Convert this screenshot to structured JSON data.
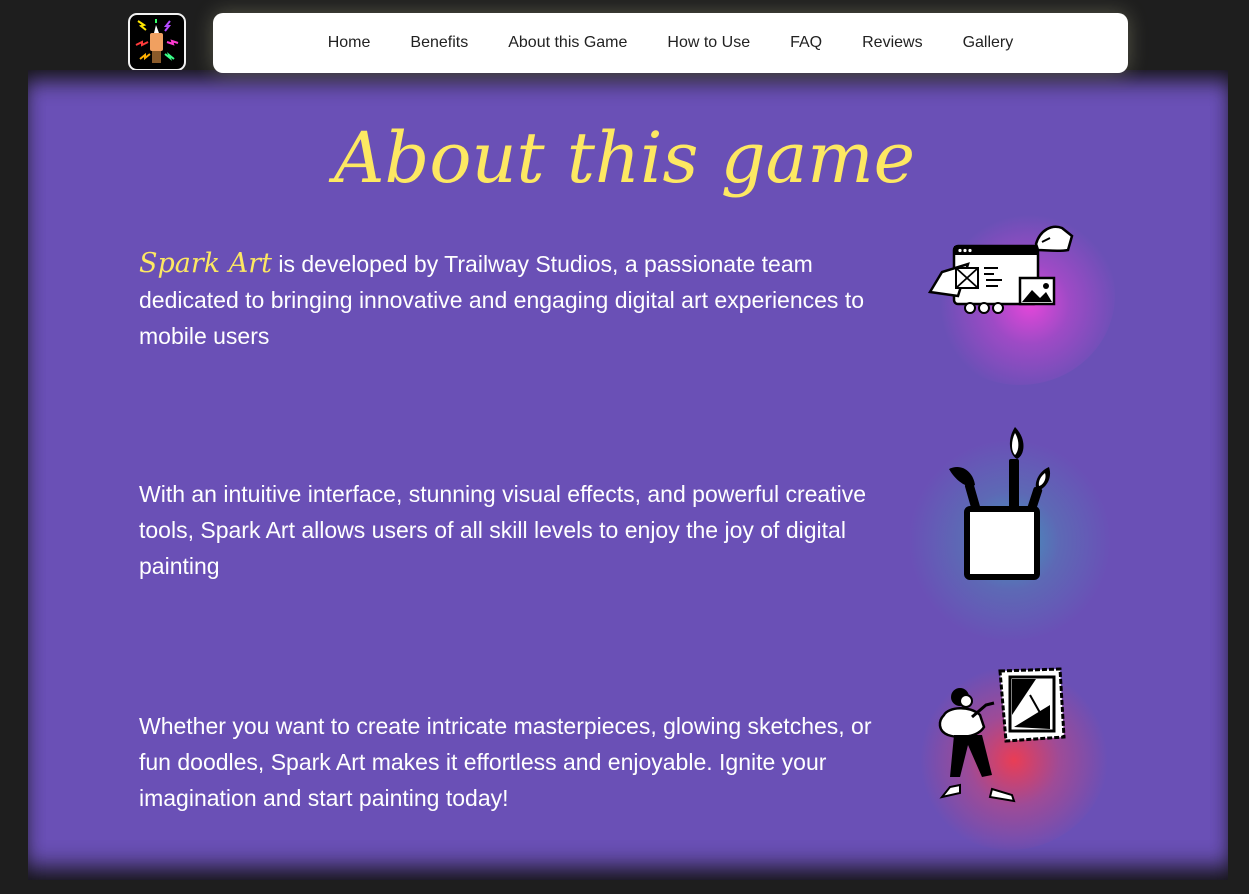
{
  "nav": {
    "items": [
      "Home",
      "Benefits",
      "About this Game",
      "How to Use",
      "FAQ",
      "Reviews",
      "Gallery"
    ]
  },
  "about": {
    "title": "About this game",
    "p1_brand": "Spark Art",
    "p1_rest": " is developed by Trailway Studios, a passionate team dedicated to bringing innovative and engaging digital art experiences to mobile users",
    "p2": "With an intuitive interface, stunning visual effects, and powerful creative tools, Spark Art allows users of all skill levels to enjoy the joy of digital painting",
    "p3": "Whether you want to create intricate masterpieces, glowing sketches, or fun doodles, Spark Art makes it effortless and enjoyable. Ignite your imagination and start painting today!"
  },
  "icons": {
    "logo": "spark-brush-logo-icon",
    "illustration_1": "web-design-illustration",
    "illustration_2": "paintbrush-jar-illustration",
    "illustration_3": "person-viewing-artwork-illustration"
  },
  "colors": {
    "background": "#1e1e1e",
    "panel": "#6a50b6",
    "accent": "#fde862",
    "nav_bg": "#ffffff"
  }
}
